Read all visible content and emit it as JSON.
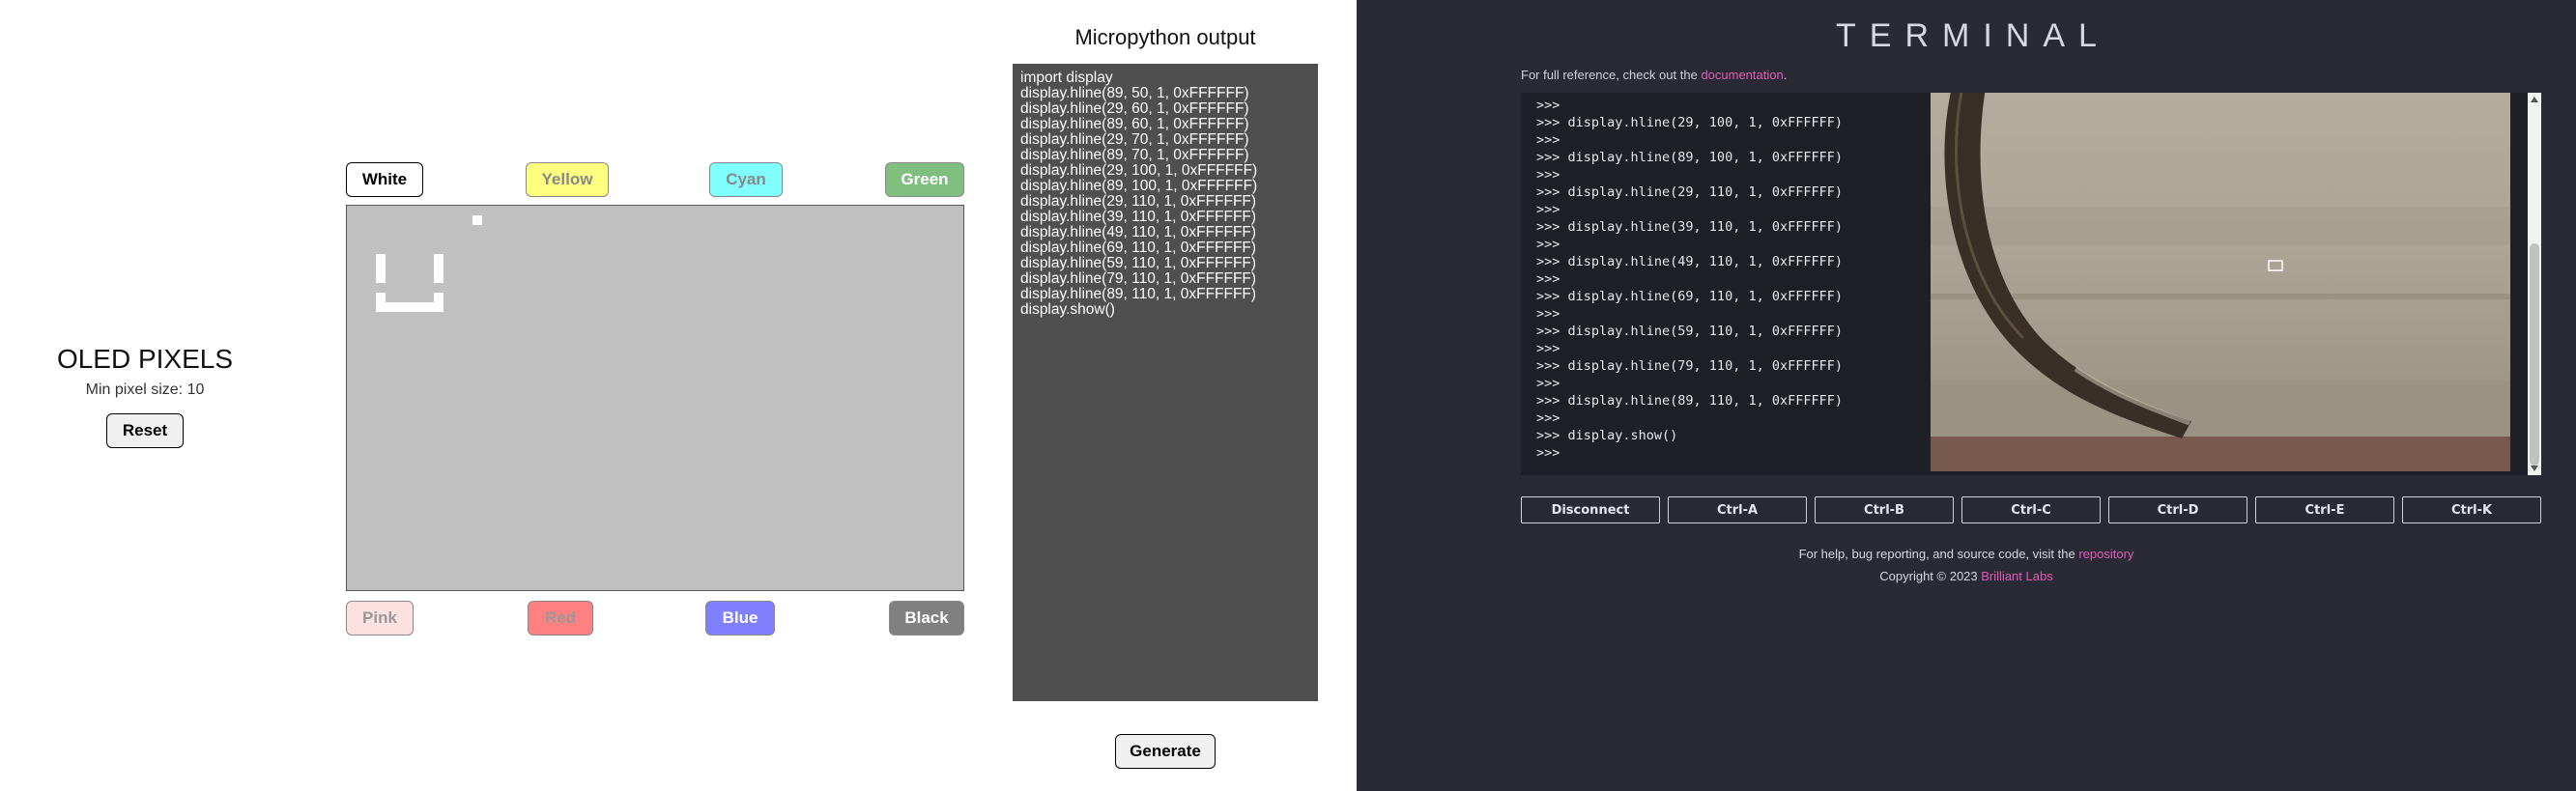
{
  "oled": {
    "title": "OLED PIXELS",
    "min_pixel_label": "Min pixel size: 10",
    "reset_label": "Reset"
  },
  "palette": {
    "top": [
      {
        "label": "White",
        "color": "#ffffff",
        "text_color": "#000000"
      },
      {
        "label": "Yellow",
        "color": "#ffff80",
        "text_color": "#888888"
      },
      {
        "label": "Cyan",
        "color": "#80ffff",
        "text_color": "#888888"
      },
      {
        "label": "Green",
        "color": "#80bf80",
        "text_color": "#ffffff"
      }
    ],
    "bottom": [
      {
        "label": "Pink",
        "color": "#fde0e0",
        "text_color": "#999999"
      },
      {
        "label": "Red",
        "color": "#ff8080",
        "text_color": "#999999"
      },
      {
        "label": "Blue",
        "color": "#8080ff",
        "text_color": "#ffffff"
      },
      {
        "label": "Black",
        "color": "#808080",
        "text_color": "#ffffff"
      }
    ]
  },
  "micropython": {
    "title": "Micropython output",
    "code": "import display\ndisplay.hline(89, 50, 1, 0xFFFFFF)\ndisplay.hline(29, 60, 1, 0xFFFFFF)\ndisplay.hline(89, 60, 1, 0xFFFFFF)\ndisplay.hline(29, 70, 1, 0xFFFFFF)\ndisplay.hline(89, 70, 1, 0xFFFFFF)\ndisplay.hline(29, 100, 1, 0xFFFFFF)\ndisplay.hline(89, 100, 1, 0xFFFFFF)\ndisplay.hline(29, 110, 1, 0xFFFFFF)\ndisplay.hline(39, 110, 1, 0xFFFFFF)\ndisplay.hline(49, 110, 1, 0xFFFFFF)\ndisplay.hline(69, 110, 1, 0xFFFFFF)\ndisplay.hline(59, 110, 1, 0xFFFFFF)\ndisplay.hline(79, 110, 1, 0xFFFFFF)\ndisplay.hline(89, 110, 1, 0xFFFFFF)\ndisplay.show()",
    "generate_label": "Generate"
  },
  "terminal": {
    "title": "TERMINAL",
    "ref_prefix": "For full reference, check out the ",
    "ref_link": "documentation",
    "ref_suffix": ".",
    "lines": ">>>\n>>> display.hline(29, 100, 1, 0xFFFFFF)\n>>>\n>>> display.hline(89, 100, 1, 0xFFFFFF)\n>>>\n>>> display.hline(29, 110, 1, 0xFFFFFF)\n>>>\n>>> display.hline(39, 110, 1, 0xFFFFFF)\n>>>\n>>> display.hline(49, 110, 1, 0xFFFFFF)\n>>>\n>>> display.hline(69, 110, 1, 0xFFFFFF)\n>>>\n>>> display.hline(59, 110, 1, 0xFFFFFF)\n>>>\n>>> display.hline(79, 110, 1, 0xFFFFFF)\n>>>\n>>> display.hline(89, 110, 1, 0xFFFFFF)\n>>>\n>>> display.show()\n>>>",
    "buttons": [
      "Disconnect",
      "Ctrl-A",
      "Ctrl-B",
      "Ctrl-C",
      "Ctrl-D",
      "Ctrl-E",
      "Ctrl-K"
    ],
    "help_prefix": "For help, bug reporting, and source code, visit the ",
    "help_link": "repository",
    "copyright_prefix": "Copyright © 2023 ",
    "copyright_link": "Brilliant Labs",
    "accent_color": "#e05bb6"
  }
}
